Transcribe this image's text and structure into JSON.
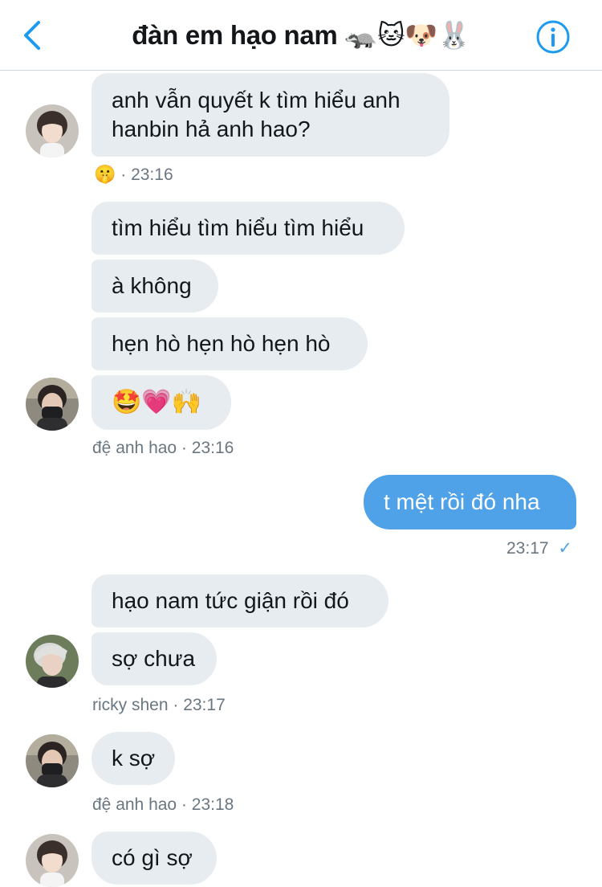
{
  "header": {
    "title": "đàn em hạo nam 🦡🐱🐶🐰"
  },
  "messages": [
    {
      "text": "anh vẫn quyết k tìm hiểu anh hanbin hả anh hao?"
    },
    {
      "reaction": "🤫",
      "time": "· 23:16"
    },
    {
      "text": "tìm hiểu tìm hiểu tìm hiểu"
    },
    {
      "text": "à không"
    },
    {
      "text": "hẹn hò hẹn hò hẹn hò"
    },
    {
      "text": "🤩💗🙌"
    },
    {
      "meta": "đệ anh hao · 23:16"
    },
    {
      "text": "t mệt rồi đó nha"
    },
    {
      "meta": "23:17",
      "check": "✓"
    },
    {
      "text": "hạo nam tức giận rồi đó"
    },
    {
      "text": "sợ chưa"
    },
    {
      "meta": "ricky shen · 23:17"
    },
    {
      "text": "k sợ"
    },
    {
      "meta": "đệ anh hao · 23:18"
    },
    {
      "text": "có gì sợ"
    }
  ],
  "colors": {
    "received_bubble": "#e6ecf0",
    "sent_bubble": "#4fa2e8",
    "accent": "#1d9bf0"
  }
}
